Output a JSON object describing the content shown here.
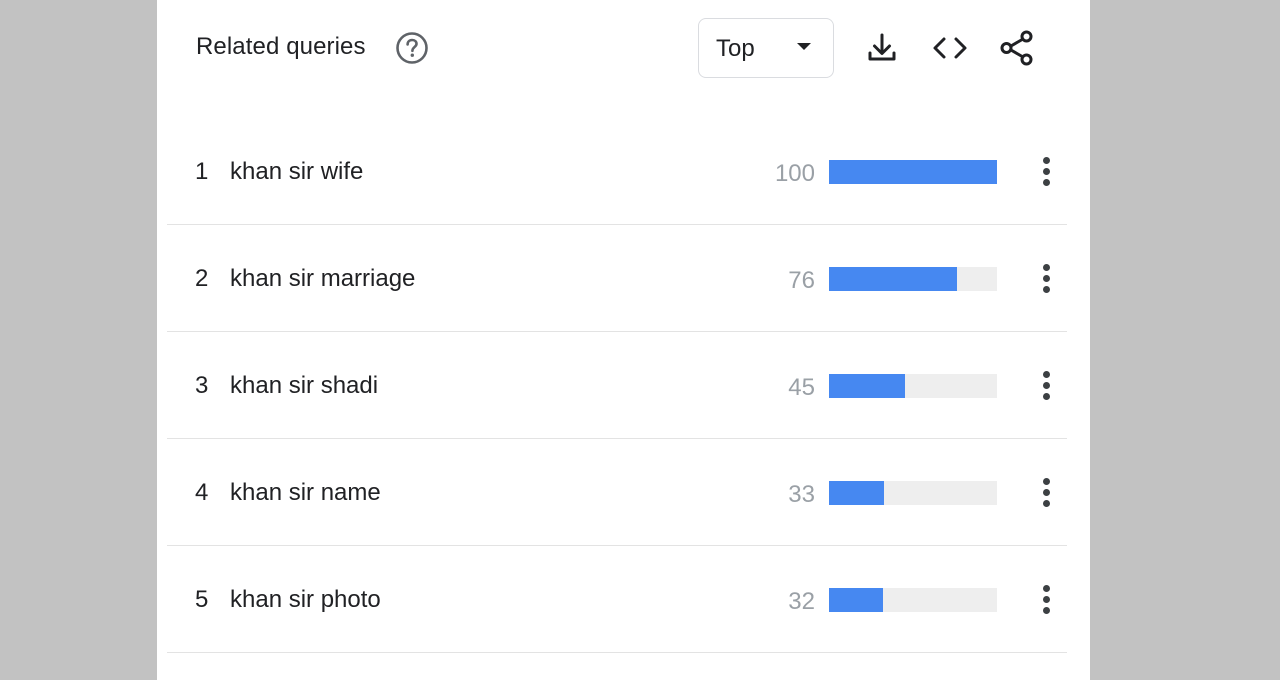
{
  "panel": {
    "title": "Related queries",
    "help_icon": "help-circle-icon",
    "sort_dropdown": {
      "selected": "Top"
    },
    "toolbar": {
      "download_icon": "download-icon",
      "embed_icon": "code-icon",
      "share_icon": "share-icon"
    }
  },
  "queries": [
    {
      "rank": "1",
      "query": "khan sir wife",
      "value": "100",
      "level": 1.0
    },
    {
      "rank": "2",
      "query": "khan sir marriage",
      "value": "76",
      "level": 0.76
    },
    {
      "rank": "3",
      "query": "khan sir shadi",
      "value": "45",
      "level": 0.45
    },
    {
      "rank": "4",
      "query": "khan sir name",
      "value": "33",
      "level": 0.33
    },
    {
      "rank": "5",
      "query": "khan sir photo",
      "value": "32",
      "level": 0.32
    }
  ],
  "colors": {
    "bar_fill": "#4688f1",
    "bar_track": "#eeeeee",
    "value_text": "#9aa0a6",
    "background": "#c2c2c2"
  }
}
